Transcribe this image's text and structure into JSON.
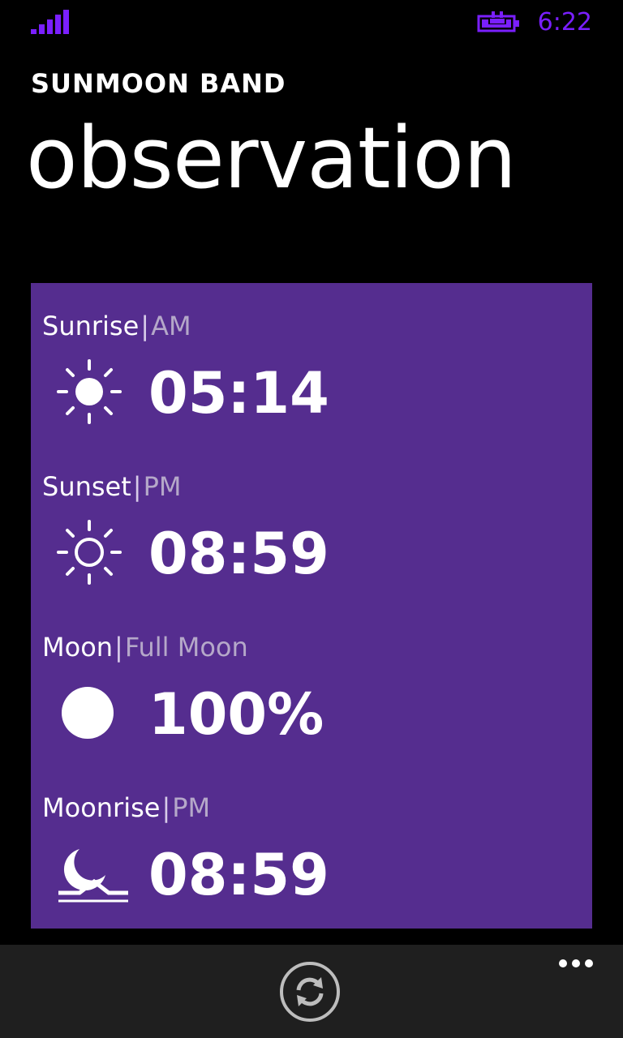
{
  "status_bar": {
    "time": "6:22",
    "accent_color": "#7a1fff",
    "signal_icon": "signal-bars-icon",
    "battery_icon": "battery-charging-icon"
  },
  "header": {
    "app_name": "SUNMOON BAND",
    "page_title": "observation"
  },
  "card": {
    "background": "#552d8f",
    "items": [
      {
        "name": "Sunrise",
        "separator": "|",
        "sub": "AM",
        "value": "05:14",
        "icon": "sun-filled-icon"
      },
      {
        "name": "Sunset",
        "separator": "|",
        "sub": "PM",
        "value": "08:59",
        "icon": "sun-outline-icon"
      },
      {
        "name": "Moon",
        "separator": "|",
        "sub": "Full Moon",
        "value": "100%",
        "icon": "full-moon-icon"
      },
      {
        "name": "Moonrise",
        "separator": "|",
        "sub": "PM",
        "value": "08:59",
        "icon": "moonrise-icon"
      }
    ]
  },
  "app_bar": {
    "background": "#1f1f1f",
    "refresh_icon": "refresh-icon",
    "more_icon": "more-dots-icon"
  }
}
